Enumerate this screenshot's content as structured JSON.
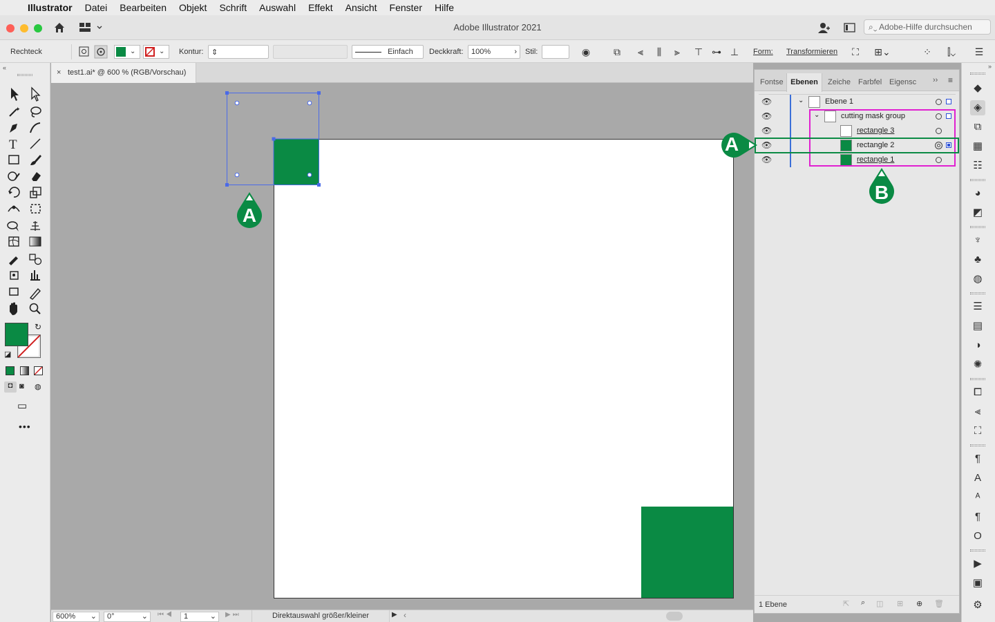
{
  "menubar": {
    "app": "Illustrator",
    "items": [
      "Datei",
      "Bearbeiten",
      "Objekt",
      "Schrift",
      "Auswahl",
      "Effekt",
      "Ansicht",
      "Fenster",
      "Hilfe"
    ]
  },
  "window": {
    "title": "Adobe Illustrator 2021",
    "search_placeholder": "Adobe-Hilfe durchsuchen"
  },
  "controlbar": {
    "object_type": "Rechteck",
    "stroke_label": "Kontur:",
    "stroke_style": "Einfach",
    "opacity_label": "Deckkraft:",
    "opacity_value": "100%",
    "style_label": "Stil:",
    "shape_label": "Form:",
    "transform_label": "Transformieren",
    "fill_color": "#0a8a44"
  },
  "document": {
    "tab_title": "test1.ai* @ 600 % (RGB/Vorschau)"
  },
  "statusbar": {
    "zoom": "600%",
    "rotation": "0°",
    "artboard": "1",
    "status_text": "Direktauswahl größer/kleiner"
  },
  "panel": {
    "tabs": [
      "Fontse",
      "Ebenen",
      "Zeiche",
      "Farbfel",
      "Eigensc"
    ],
    "active_tab": "Ebenen",
    "layers": [
      {
        "name": "Ebene 1",
        "level": 0,
        "expanded": true,
        "swatch": "white"
      },
      {
        "name": "cutting mask group",
        "level": 1,
        "expanded": true,
        "swatch": "white"
      },
      {
        "name": "rectangle 3",
        "level": 2,
        "swatch": "white"
      },
      {
        "name": "rectangle 2",
        "level": 2,
        "swatch": "green",
        "selected": true
      },
      {
        "name": "rectangle 1",
        "level": 2,
        "swatch": "green"
      }
    ],
    "footer_text": "1 Ebene"
  },
  "callouts": {
    "a_label": "A",
    "b_label": "B",
    "color": "#0a8a44",
    "highlight_color": "#e020d0"
  },
  "icons": {
    "left_toolbar": [
      "selection-tool",
      "direct-selection-tool",
      "magic-wand-tool",
      "lasso-tool",
      "pen-tool",
      "curvature-tool",
      "type-tool",
      "line-tool",
      "rectangle-tool",
      "paintbrush-tool",
      "shaper-tool",
      "eraser-tool",
      "rotate-tool",
      "scale-tool",
      "width-tool",
      "free-transform-tool",
      "shape-builder-tool",
      "perspective-grid-tool",
      "mesh-tool",
      "gradient-tool",
      "eyedropper-tool",
      "blend-tool",
      "symbol-sprayer-tool",
      "column-graph-tool",
      "artboard-tool",
      "slice-tool",
      "hand-tool",
      "zoom-tool"
    ]
  }
}
